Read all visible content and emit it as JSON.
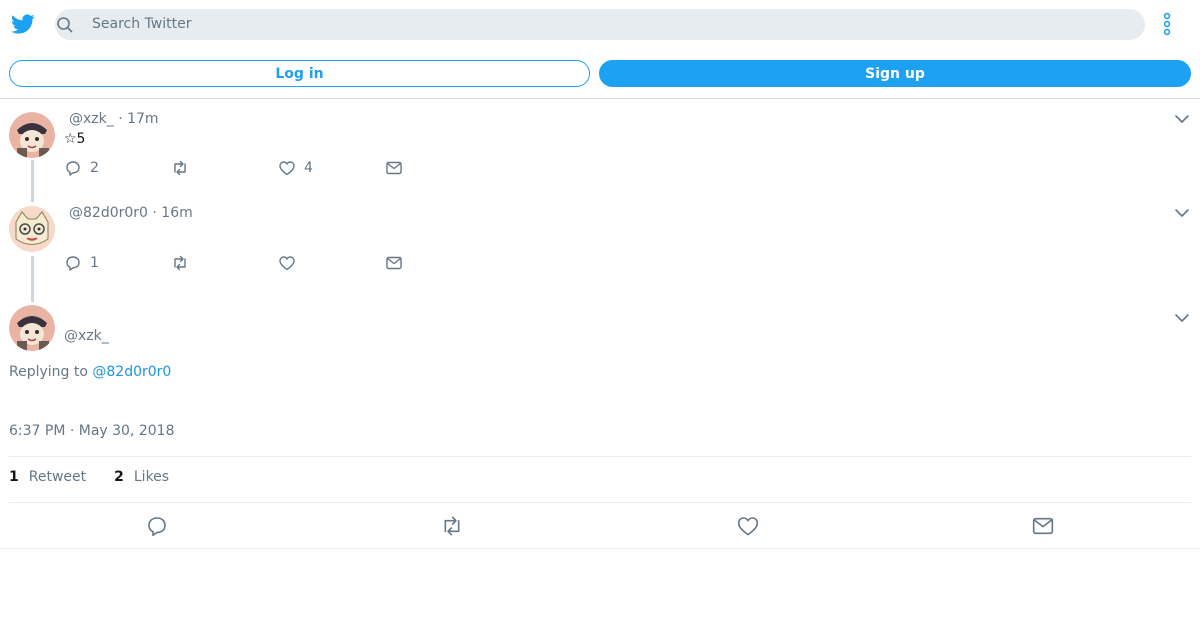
{
  "header": {
    "search_placeholder": "Search Twitter",
    "login_label": "Log in",
    "signup_label": "Sign up"
  },
  "tweets": [
    {
      "handle": "@xzk_",
      "time": "· 17m",
      "text": "☆5",
      "replies": "2",
      "retweets": "",
      "likes": "4"
    },
    {
      "handle": "@82d0r0r0",
      "time": "· 16m",
      "text": "",
      "replies": "1",
      "retweets": "",
      "likes": ""
    }
  ],
  "main_tweet": {
    "handle": "@xzk_",
    "replying_prefix": "Replying to",
    "replying_to": "@82d0r0r0",
    "timestamp": "6:37 PM · May 30, 2018",
    "retweet_count": "1",
    "retweet_label": "Retweet",
    "like_count": "2",
    "like_label": "Likes"
  },
  "colors": {
    "accent": "#1da1f2",
    "link": "#1b95e0",
    "muted": "#657786",
    "search_bg": "#e6ecf0"
  },
  "icons": [
    "twitter-bird-icon",
    "search-icon",
    "more-vertical-icon",
    "chevron-down-icon",
    "reply-icon",
    "retweet-icon",
    "like-icon",
    "message-icon"
  ]
}
